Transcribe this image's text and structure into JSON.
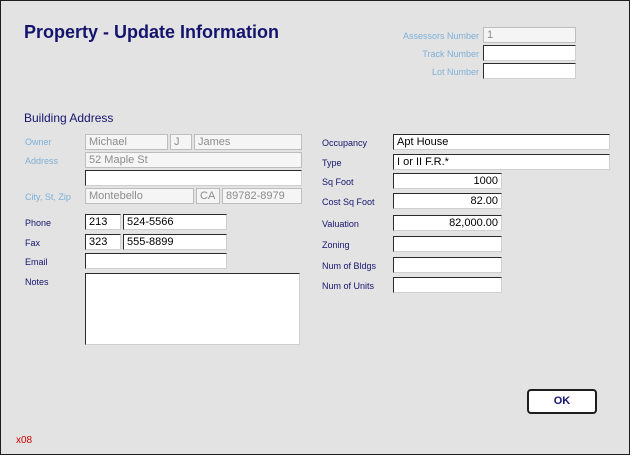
{
  "window": {
    "title": "Property - Update Information",
    "section_title": "Building Address",
    "code": "x08"
  },
  "ids": {
    "assessors_number": {
      "label": "Assessors Number",
      "value": "1"
    },
    "track_number": {
      "label": "Track Number",
      "value": ""
    },
    "lot_number": {
      "label": "Lot Number",
      "value": ""
    }
  },
  "owner": {
    "label": "Owner",
    "first": "Michael",
    "middle": "J",
    "last": "James"
  },
  "address": {
    "label": "Address",
    "line1": "52 Maple St",
    "line2": ""
  },
  "city_state_zip": {
    "label": "City, St, Zip",
    "city": "Montebello",
    "state": "CA",
    "zip": "89782-8979"
  },
  "phone": {
    "label": "Phone",
    "area": "213",
    "number": "524-5566"
  },
  "fax": {
    "label": "Fax",
    "area": "323",
    "number": "555-8899"
  },
  "email": {
    "label": "Email",
    "value": ""
  },
  "notes": {
    "label": "Notes",
    "value": ""
  },
  "property": {
    "occupancy": {
      "label": "Occupancy",
      "value": "Apt House"
    },
    "type": {
      "label": "Type",
      "value": "I or II F.R.*"
    },
    "sq_foot": {
      "label": "Sq Foot",
      "value": "1000"
    },
    "cost_sq_foot": {
      "label": "Cost Sq Foot",
      "value": "82.00"
    },
    "valuation": {
      "label": "Valuation",
      "value": "82,000.00"
    },
    "zoning": {
      "label": "Zoning",
      "value": ""
    },
    "num_bldgs": {
      "label": "Num of Bldgs",
      "value": ""
    },
    "num_units": {
      "label": "Num of Units",
      "value": ""
    }
  },
  "buttons": {
    "ok": "OK"
  }
}
